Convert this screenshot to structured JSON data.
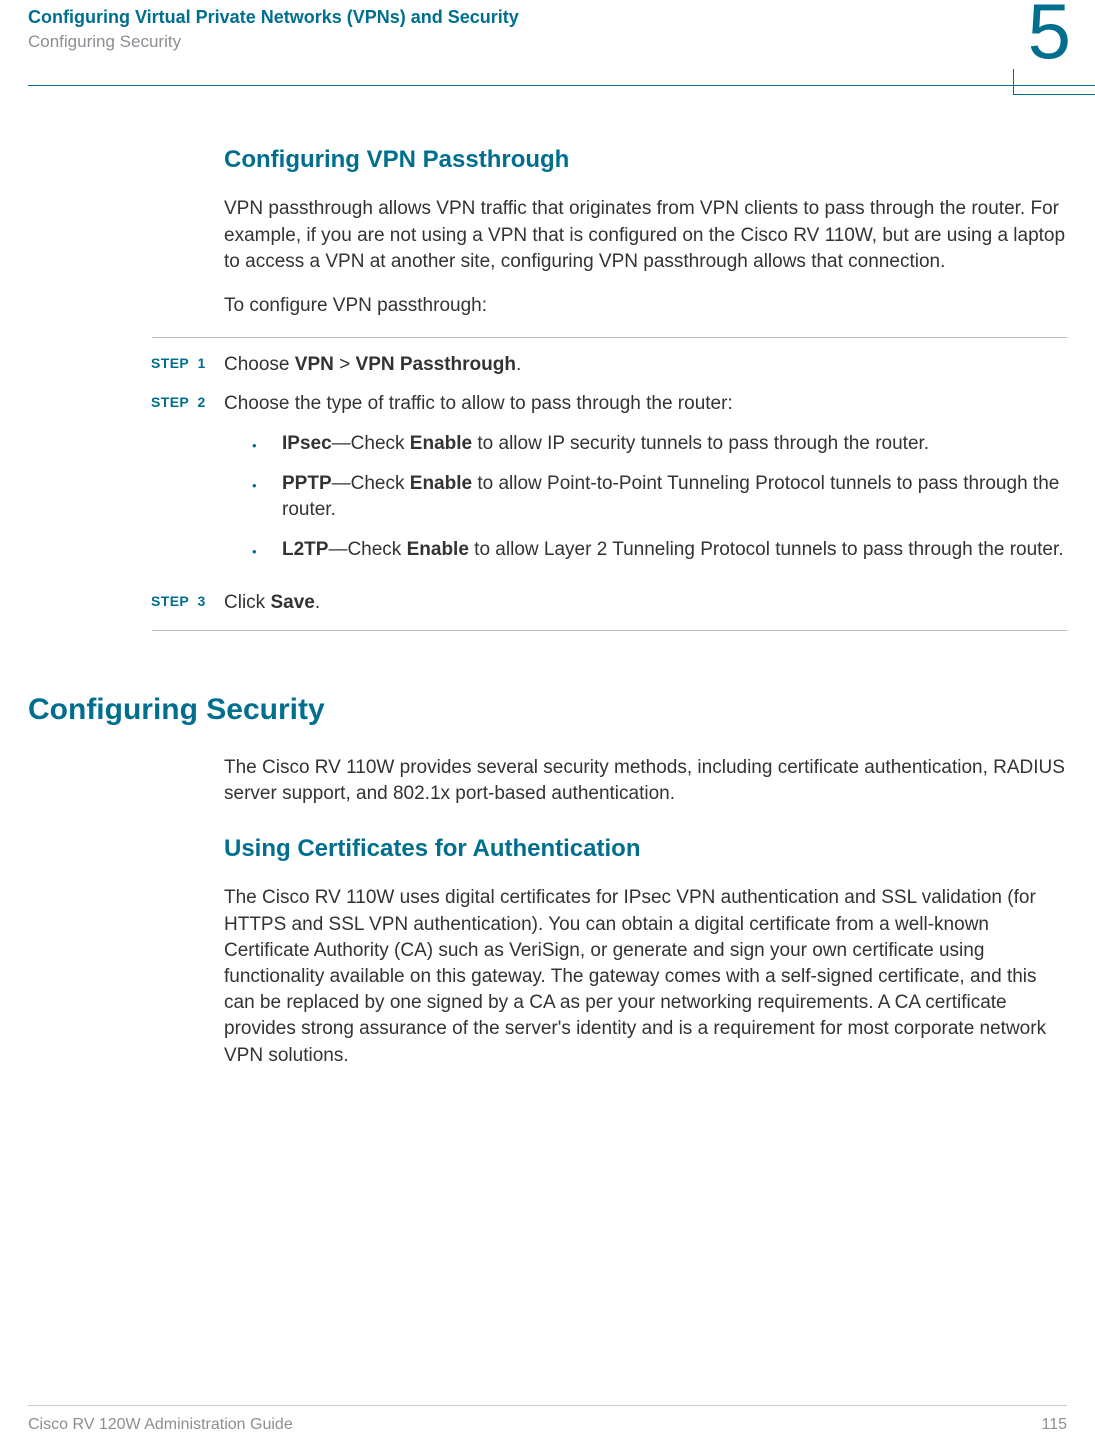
{
  "header": {
    "title": "Configuring Virtual Private Networks (VPNs) and Security",
    "subtitle": "Configuring Security",
    "chapter_number": "5"
  },
  "section_vpn_pass": {
    "heading": "Configuring VPN Passthrough",
    "p1": "VPN passthrough allows VPN traffic that originates from VPN clients to pass through the router. For example, if you are not using a VPN that is configured on the Cisco RV 110W, but are using a laptop to access a VPN at another site, configuring VPN passthrough allows that connection.",
    "p2": "To configure VPN passthrough:"
  },
  "steps": [
    {
      "label": "STEP  1",
      "prefix": "Choose ",
      "bold1": "VPN",
      "mid": " > ",
      "bold2": "VPN Passthrough",
      "suffix": "."
    },
    {
      "label": "STEP  2",
      "text": "Choose the type of traffic to allow to pass through the router:",
      "bullets": [
        {
          "bold1": "IPsec",
          "mid": "—Check ",
          "bold2": "Enable",
          "rest": " to allow IP security tunnels to pass through the router."
        },
        {
          "bold1": "PPTP",
          "mid": "—Check ",
          "bold2": "Enable",
          "rest": " to allow Point-to-Point Tunneling Protocol tunnels to pass through the router."
        },
        {
          "bold1": "L2TP",
          "mid": "—Check ",
          "bold2": "Enable",
          "rest": " to allow Layer 2 Tunneling Protocol tunnels to pass through the router."
        }
      ]
    },
    {
      "label": "STEP  3",
      "prefix": "Click ",
      "bold1": "Save",
      "suffix": "."
    }
  ],
  "section_security": {
    "heading": "Configuring Security",
    "p1": "The Cisco RV 110W provides several security methods, including certificate authentication, RADIUS server support, and 802.1x port-based authentication."
  },
  "section_certs": {
    "heading": "Using Certificates for Authentication",
    "p1": "The Cisco RV 110W uses digital certificates for IPsec VPN authentication and SSL validation (for HTTPS and SSL VPN authentication). You can obtain a digital certificate from a well-known Certificate Authority (CA) such as VeriSign, or generate and sign your own certificate using functionality available on this gateway. The gateway comes with a self-signed certificate, and this can be replaced by one signed by a CA as per your networking requirements.   A CA certificate provides strong assurance of the server's identity and is a requirement for most corporate network VPN solutions."
  },
  "footer": {
    "guide": "Cisco RV 120W Administration Guide",
    "page": "115"
  },
  "colors": {
    "accent": "#006f8f",
    "muted": "#8b8f94"
  }
}
